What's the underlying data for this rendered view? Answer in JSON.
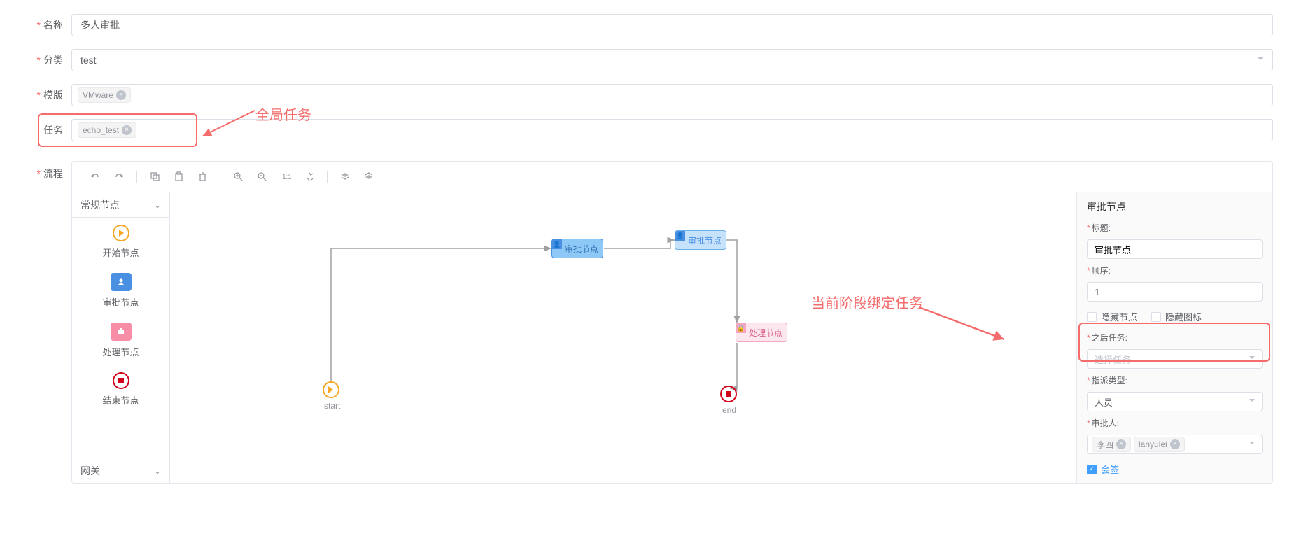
{
  "form": {
    "name_label": "名称",
    "name_value": "多人审批",
    "category_label": "分类",
    "category_value": "test",
    "template_label": "模版",
    "template_tags": [
      "VMware"
    ],
    "task_label": "任务",
    "task_tags": [
      "echo_test"
    ]
  },
  "annotations": {
    "global_task": "全局任务",
    "current_stage_bind_task": "当前阶段绑定任务"
  },
  "flow": {
    "label": "流程",
    "palette": {
      "header": "常规节点",
      "items": {
        "start": "开始节点",
        "approve": "审批节点",
        "process": "处理节点",
        "end": "结束节点"
      },
      "footer": "网关"
    },
    "canvas": {
      "start_label": "start",
      "end_label": "end",
      "node1_label": "审批节点",
      "node2_label": "审批节点",
      "node3_label": "处理节点"
    }
  },
  "right_panel": {
    "title": "审批节点",
    "title_label": "标题:",
    "title_value": "审批节点",
    "order_label": "顺序:",
    "order_value": "1",
    "hide_node_label": "隐藏节点",
    "hide_icon_label": "隐藏图标",
    "after_task_label": "之后任务:",
    "after_task_placeholder": "选择任务",
    "assign_type_label": "指派类型:",
    "assign_type_value": "人员",
    "approver_label": "审批人:",
    "approver_tags": [
      "李四",
      "lanyulei"
    ],
    "cosign_label": "会签"
  }
}
